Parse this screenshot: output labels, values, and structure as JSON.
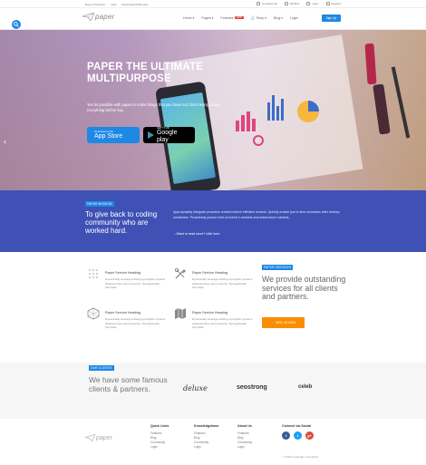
{
  "topbar": {
    "left_links": [
      "Buyer Protection",
      "Help",
      "Download Mobile App"
    ],
    "right_links": [
      {
        "label": "Compare list",
        "icon": "compare-icon"
      },
      {
        "label": "Wishlist",
        "icon": "heart-icon"
      },
      {
        "label": "Login",
        "icon": "user-icon"
      },
      {
        "label": "Register",
        "icon": "register-icon"
      }
    ]
  },
  "header": {
    "logo_text": "paper",
    "nav": [
      "Home",
      "Pages",
      "Features",
      "Shop",
      "Blog",
      "Login"
    ],
    "features_badge": "NEW",
    "signup_label": "Sign Up"
  },
  "hero": {
    "title": "PAPER THE ULTIMATE MULTIPURPOSE",
    "subtitle": "Yes its possible with paper to make things that you have not. Don't worry chose everything before buy",
    "app_store": {
      "small": "Download on the",
      "big": "App Store"
    },
    "google_play": {
      "small": "GET IT ON",
      "big": "Google play"
    }
  },
  "mission": {
    "tag": "PAPER MISSION",
    "heading": "To give back to coding community who are worked hard.",
    "paragraph": "Appropriately integrate proactive content before effective models. Quickly enable just in time scenarios after turnkey mindshare. Proactively pursue best-of-breed e-markets and stand-store markets.",
    "link": "Want to read more? click here."
  },
  "services": {
    "tag": "PAPER SERVICES",
    "heading": "We provide outstanding services for all clients and partners.",
    "hire_label": "HIRE US NOW",
    "items": [
      {
        "title": "Paper Service Heading",
        "desc": "Dynamically leverage existing synergistic systems whereas future-proof sources. Synergistically formulate",
        "icon": "grid-dots-icon"
      },
      {
        "title": "Paper Service Heading",
        "desc": "Dynamically leverage existing synergistic systems whereas future-proof sources. Synergistically formulate",
        "icon": "tools-icon"
      },
      {
        "title": "Paper Service Heading",
        "desc": "Dynamically leverage existing synergistic systems whereas future-proof sources. Synergistically formulate",
        "icon": "hexagon-icon"
      },
      {
        "title": "Paper Service Heading",
        "desc": "Dynamically leverage existing synergistic systems whereas future-proof sources. Synergistically formulate",
        "icon": "map-icon"
      }
    ]
  },
  "clients": {
    "tag": "OUR CLIENTS",
    "heading": "We have some famous clients & partners.",
    "logos": [
      "deluxe",
      "seostrong",
      "celeb"
    ]
  },
  "footer": {
    "logo_text": "paper",
    "columns": [
      {
        "heading": "Quick Links",
        "links": [
          "Features",
          "Blog",
          "Community",
          "Login"
        ]
      },
      {
        "heading": "Knowledgebase",
        "links": [
          "Features",
          "Blog",
          "Community",
          "Login"
        ]
      },
      {
        "heading": "About Us",
        "links": [
          "Features",
          "Blog",
          "Community",
          "Login"
        ]
      }
    ],
    "social_heading": "Connect via Social",
    "social": [
      {
        "label": "f",
        "color": "#3b5998"
      },
      {
        "label": "t",
        "color": "#1da1f2"
      },
      {
        "label": "g+",
        "color": "#dd4b39"
      }
    ],
    "copyright": "© 2016 knowledge Copyrights"
  },
  "colors": {
    "accent": "#1e88e5",
    "mission_bg": "#3f51b5",
    "hire": "#fb8c00"
  }
}
